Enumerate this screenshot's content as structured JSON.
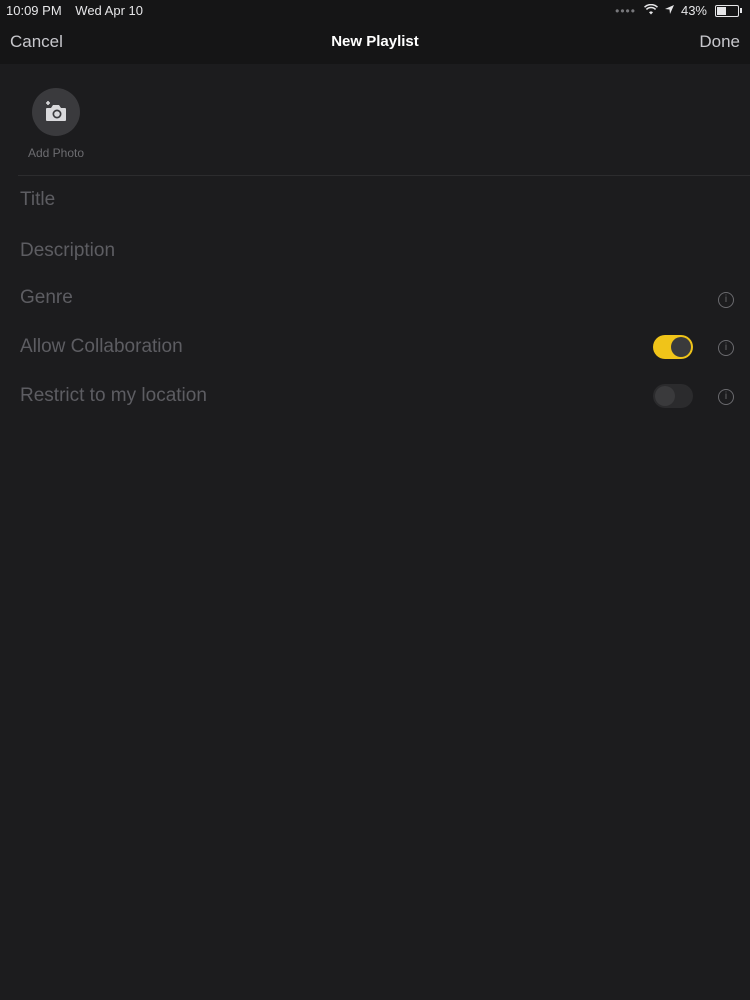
{
  "status": {
    "time": "10:09 PM",
    "date": "Wed Apr 10",
    "battery_percent": "43%",
    "battery_level": 0.43
  },
  "nav": {
    "cancel": "Cancel",
    "title": "New Playlist",
    "done": "Done"
  },
  "photo": {
    "label": "Add Photo"
  },
  "form": {
    "title_placeholder": "Title",
    "description_placeholder": "Description",
    "genre_label": "Genre",
    "collaboration_label": "Allow Collaboration",
    "collaboration_on": true,
    "restrict_label": "Restrict to my location",
    "restrict_on": false
  },
  "colors": {
    "accent": "#f0c419",
    "background": "#1c1c1e"
  }
}
